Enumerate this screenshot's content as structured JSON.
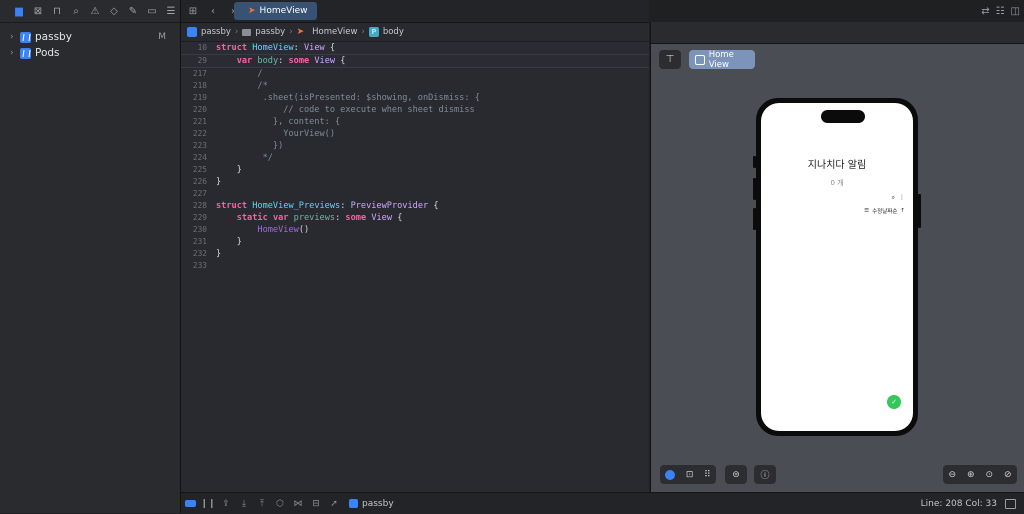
{
  "navigator": {
    "icons": [
      "folder-icon",
      "close-square-icon",
      "hierarchy-icon",
      "search-icon",
      "warning-icon",
      "test-diamond-icon",
      "debug-icon",
      "breakpoint-icon",
      "report-icon"
    ],
    "items": [
      {
        "label": "passby",
        "badge": "M"
      },
      {
        "label": "Pods",
        "badge": ""
      }
    ]
  },
  "tab": {
    "label": "HomeView"
  },
  "breadcrumb": [
    "passby",
    "passby",
    "HomeView",
    "body"
  ],
  "code": {
    "sticky": [
      {
        "num": "10",
        "text": "struct HomeView: View {"
      },
      {
        "num": "29",
        "text": "    var body: some View {"
      }
    ],
    "lines": [
      {
        "num": "217",
        "text": "        /"
      },
      {
        "num": "218",
        "text": "        /*"
      },
      {
        "num": "219",
        "text": "         .sheet(isPresented: $showing, onDismiss: {"
      },
      {
        "num": "220",
        "text": "             // code to execute when sheet dismiss"
      },
      {
        "num": "221",
        "text": "           }, content: {"
      },
      {
        "num": "222",
        "text": "             YourView()"
      },
      {
        "num": "223",
        "text": "           })"
      },
      {
        "num": "224",
        "text": "         */"
      },
      {
        "num": "225",
        "text": "    }"
      },
      {
        "num": "226",
        "text": "}"
      },
      {
        "num": "227",
        "text": ""
      },
      {
        "num": "228",
        "text": "struct HomeView_Previews: PreviewProvider {"
      },
      {
        "num": "229",
        "text": "    static var previews: some View {"
      },
      {
        "num": "230",
        "text": "        HomeView()"
      },
      {
        "num": "231",
        "text": "    }"
      },
      {
        "num": "232",
        "text": "}"
      },
      {
        "num": "233",
        "text": ""
      }
    ]
  },
  "preview": {
    "pill_label": "Home View",
    "app": {
      "title": "지나치다 알림",
      "count": "0 개",
      "sort_label": "수정날짜순"
    }
  },
  "statusbar": {
    "scheme": "passby",
    "line_col": "Line: 208  Col: 33"
  },
  "colors": {
    "accent": "#3b82f6",
    "tab": "#385273",
    "fab": "#34c759"
  }
}
